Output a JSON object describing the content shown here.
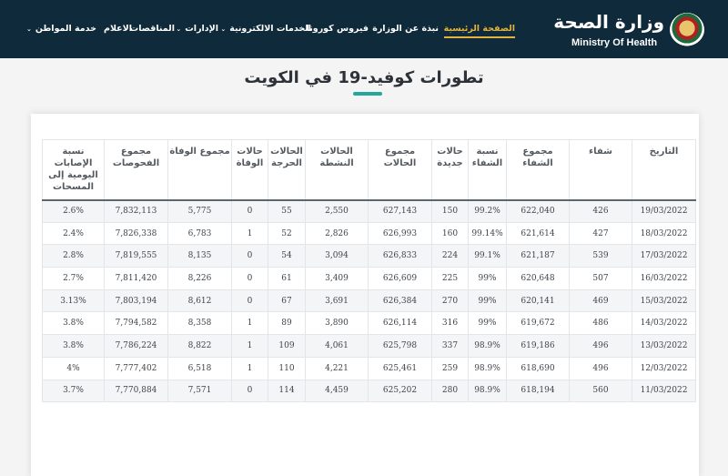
{
  "header": {
    "logo_ar": "وزارة الصحة",
    "logo_en": "Ministry Of Health",
    "nav": [
      {
        "label": "الصفحة الرئيسية",
        "active": true,
        "dropdown": false
      },
      {
        "label": "نبذة عن الوزارة",
        "active": false,
        "dropdown": false
      },
      {
        "label": "فيروس كورونا",
        "active": false,
        "dropdown": true
      },
      {
        "label": "الخدمات الالكترونية",
        "active": false,
        "dropdown": true
      },
      {
        "label": "الإدارات",
        "active": false,
        "dropdown": true
      },
      {
        "label": "المناقصات",
        "active": false,
        "dropdown": false
      },
      {
        "label": "الاعلام",
        "active": false,
        "dropdown": false
      },
      {
        "label": "خدمة المواطن",
        "active": false,
        "dropdown": true
      }
    ],
    "active_color": "#e3b23c",
    "bar_color": "#0f2a3a"
  },
  "page": {
    "title": "تطورات كوفيد-19 في الكويت",
    "accent_color": "#21a89a"
  },
  "table": {
    "columns": [
      "التاريخ",
      "شفاء",
      "مجموع الشفاء",
      "نسبة الشفاء",
      "حالات جديدة",
      "مجموع الحالات",
      "الحالات النشطة",
      "الحالات الحرجة",
      "حالات الوفاة",
      "مجموع الوفاة",
      "مجموع الفحوصات",
      "نسبة الإصابات اليومية إلى المسحات"
    ],
    "rows": [
      [
        "19/03/2022",
        "426",
        "622,040",
        "99.2%",
        "150",
        "627,143",
        "2,550",
        "55",
        "0",
        "5,775",
        "7,832,113",
        "2.6%"
      ],
      [
        "18/03/2022",
        "427",
        "621,614",
        "99.14%",
        "160",
        "626,993",
        "2,826",
        "52",
        "1",
        "6,783",
        "7,826,338",
        "2.4%"
      ],
      [
        "17/03/2022",
        "539",
        "621,187",
        "99.1%",
        "224",
        "626,833",
        "3,094",
        "54",
        "0",
        "8,135",
        "7,819,555",
        "2.8%"
      ],
      [
        "16/03/2022",
        "507",
        "620,648",
        "99%",
        "225",
        "626,609",
        "3,409",
        "61",
        "0",
        "8,226",
        "7,811,420",
        "2.7%"
      ],
      [
        "15/03/2022",
        "469",
        "620,141",
        "99%",
        "270",
        "626,384",
        "3,691",
        "67",
        "0",
        "8,612",
        "7,803,194",
        "3.13%"
      ],
      [
        "14/03/2022",
        "486",
        "619,672",
        "99%",
        "316",
        "626,114",
        "3,890",
        "89",
        "1",
        "8,358",
        "7,794,582",
        "3.8%"
      ],
      [
        "13/03/2022",
        "496",
        "619,186",
        "98.9%",
        "337",
        "625,798",
        "4,061",
        "109",
        "1",
        "8,822",
        "7,786,224",
        "3.8%"
      ],
      [
        "12/03/2022",
        "496",
        "618,690",
        "98.9%",
        "259",
        "625,461",
        "4,221",
        "110",
        "1",
        "6,518",
        "7,777,402",
        "4%"
      ],
      [
        "11/03/2022",
        "560",
        "618,194",
        "98.9%",
        "280",
        "625,202",
        "4,459",
        "114",
        "0",
        "7,571",
        "7,770,884",
        "3.7%"
      ]
    ]
  }
}
